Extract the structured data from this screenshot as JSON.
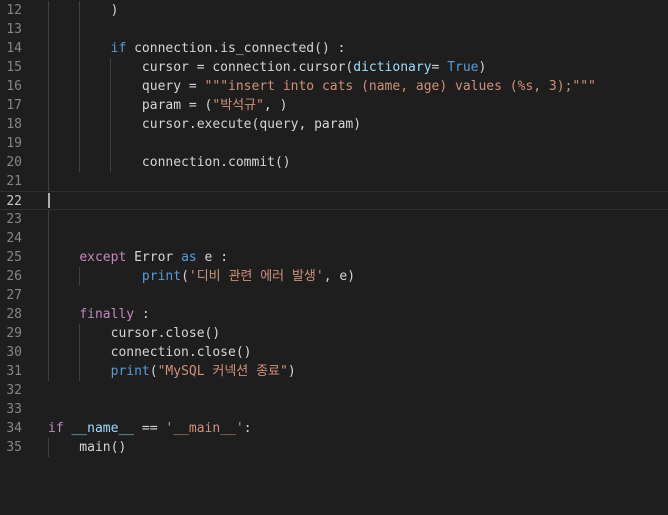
{
  "editor": {
    "lines": [
      {
        "num": "12",
        "tokens": [
          {
            "t": "        )",
            "c": "plain"
          }
        ]
      },
      {
        "num": "13",
        "tokens": []
      },
      {
        "num": "14",
        "tokens": [
          {
            "t": "        ",
            "c": "plain"
          },
          {
            "t": "if",
            "c": "kw"
          },
          {
            "t": " connection.is_connected() :",
            "c": "plain"
          }
        ]
      },
      {
        "num": "15",
        "tokens": [
          {
            "t": "            cursor = connection.cursor(",
            "c": "plain"
          },
          {
            "t": "dictionary",
            "c": "ident"
          },
          {
            "t": "= ",
            "c": "plain"
          },
          {
            "t": "True",
            "c": "kw"
          },
          {
            "t": ")",
            "c": "plain"
          }
        ]
      },
      {
        "num": "16",
        "tokens": [
          {
            "t": "            query = ",
            "c": "plain"
          },
          {
            "t": "\"\"\"insert into cats (name, age) values (%s, 3);\"\"\"",
            "c": "str"
          }
        ]
      },
      {
        "num": "17",
        "tokens": [
          {
            "t": "            param = (",
            "c": "plain"
          },
          {
            "t": "\"박석규\"",
            "c": "str"
          },
          {
            "t": ", )",
            "c": "plain"
          }
        ]
      },
      {
        "num": "18",
        "tokens": [
          {
            "t": "            cursor.execute(query, param)",
            "c": "plain"
          }
        ]
      },
      {
        "num": "19",
        "tokens": []
      },
      {
        "num": "20",
        "tokens": [
          {
            "t": "            connection.commit()",
            "c": "plain"
          }
        ]
      },
      {
        "num": "21",
        "tokens": []
      },
      {
        "num": "22",
        "tokens": [],
        "current": true
      },
      {
        "num": "23",
        "tokens": []
      },
      {
        "num": "24",
        "tokens": []
      },
      {
        "num": "25",
        "tokens": [
          {
            "t": "    ",
            "c": "plain"
          },
          {
            "t": "except",
            "c": "kw-ctrl"
          },
          {
            "t": " Error ",
            "c": "plain"
          },
          {
            "t": "as",
            "c": "kw"
          },
          {
            "t": " e :",
            "c": "plain"
          }
        ]
      },
      {
        "num": "26",
        "tokens": [
          {
            "t": "            ",
            "c": "plain"
          },
          {
            "t": "print",
            "c": "kw"
          },
          {
            "t": "(",
            "c": "plain"
          },
          {
            "t": "'디비 관련 에러 발생'",
            "c": "str"
          },
          {
            "t": ", e)",
            "c": "plain"
          }
        ]
      },
      {
        "num": "27",
        "tokens": []
      },
      {
        "num": "28",
        "tokens": [
          {
            "t": "    ",
            "c": "plain"
          },
          {
            "t": "finally",
            "c": "kw-ctrl"
          },
          {
            "t": " :",
            "c": "plain"
          }
        ]
      },
      {
        "num": "29",
        "tokens": [
          {
            "t": "        cursor.close()",
            "c": "plain"
          }
        ]
      },
      {
        "num": "30",
        "tokens": [
          {
            "t": "        connection.close()",
            "c": "plain"
          }
        ]
      },
      {
        "num": "31",
        "tokens": [
          {
            "t": "        ",
            "c": "plain"
          },
          {
            "t": "print",
            "c": "kw"
          },
          {
            "t": "(",
            "c": "plain"
          },
          {
            "t": "\"MySQL 커넥션 종료\"",
            "c": "str"
          },
          {
            "t": ")",
            "c": "plain"
          }
        ]
      },
      {
        "num": "32",
        "tokens": []
      },
      {
        "num": "33",
        "tokens": []
      },
      {
        "num": "34",
        "tokens": [
          {
            "t": "if",
            "c": "kw-ctrl"
          },
          {
            "t": " ",
            "c": "plain"
          },
          {
            "t": "__name__",
            "c": "ident"
          },
          {
            "t": " == ",
            "c": "plain"
          },
          {
            "t": "'__main__'",
            "c": "str"
          },
          {
            "t": ":",
            "c": "plain"
          }
        ]
      },
      {
        "num": "35",
        "tokens": [
          {
            "t": "    main()",
            "c": "plain"
          }
        ]
      }
    ]
  },
  "colors": {
    "background": "#1e1e1e",
    "keyword": "#569cd6",
    "control_keyword": "#c586c0",
    "string": "#ce9178",
    "identifier": "#9cdcfe",
    "text": "#d4d4d4",
    "line_number": "#858585"
  }
}
